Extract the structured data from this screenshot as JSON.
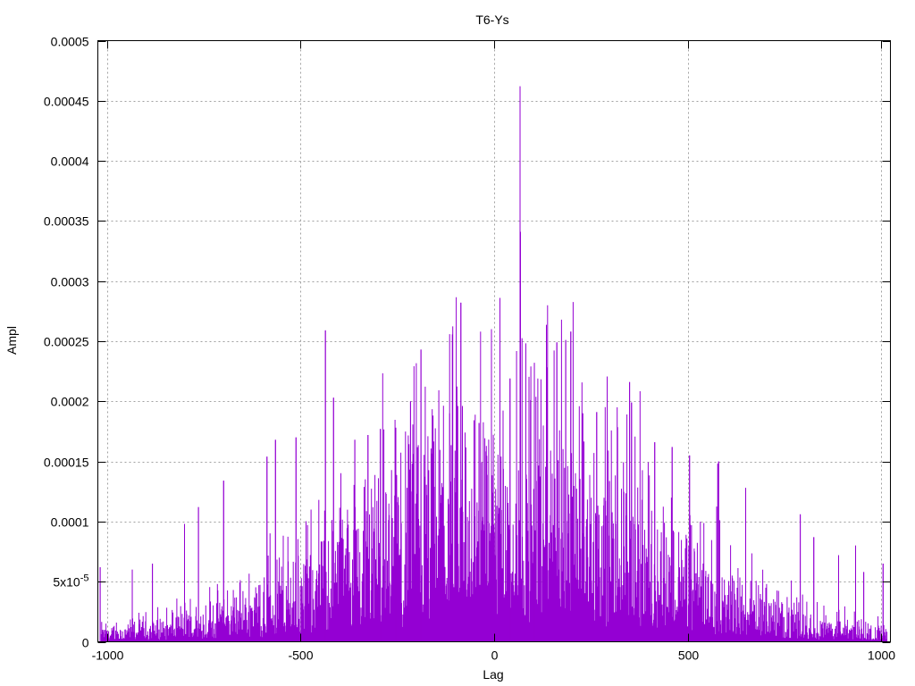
{
  "chart_data": {
    "type": "bar",
    "title": "T6-Ys",
    "xlabel": "Lag",
    "ylabel": "Ampl",
    "xlim": [
      -1024,
      1024
    ],
    "ylim": [
      0,
      0.0005
    ],
    "grid": true,
    "x_ticks": [
      {
        "value": -1000,
        "label": "-1000"
      },
      {
        "value": -500,
        "label": "-500"
      },
      {
        "value": 0,
        "label": "0"
      },
      {
        "value": 500,
        "label": "500"
      },
      {
        "value": 1000,
        "label": "1000"
      }
    ],
    "y_ticks": [
      {
        "value": 0,
        "label": "0"
      },
      {
        "value": 5e-05,
        "label": "5x10",
        "sup": "-5"
      },
      {
        "value": 0.0001,
        "label": "0.0001"
      },
      {
        "value": 0.00015,
        "label": "0.00015"
      },
      {
        "value": 0.0002,
        "label": "0.0002"
      },
      {
        "value": 0.00025,
        "label": "0.00025"
      },
      {
        "value": 0.0003,
        "label": "0.0003"
      },
      {
        "value": 0.00035,
        "label": "0.00035"
      },
      {
        "value": 0.0004,
        "label": "0.0004"
      },
      {
        "value": 0.00045,
        "label": "0.00045"
      },
      {
        "value": 0.0005,
        "label": "0.0005"
      }
    ],
    "series": [
      {
        "color": "#9400d3",
        "peaks": [
          {
            "x": 67,
            "y": 0.000462
          },
          {
            "x": 68,
            "y": 0.000341
          },
          {
            "x": 15,
            "y": 0.000286
          },
          {
            "x": -86,
            "y": 0.000282
          },
          {
            "x": -436,
            "y": 0.000259
          },
          {
            "x": 198,
            "y": 0.000258
          },
          {
            "x": 185,
            "y": 0.000251
          },
          {
            "x": 162,
            "y": 0.000249
          },
          {
            "x": -189,
            "y": 0.000243
          },
          {
            "x": 104,
            "y": 0.000232
          },
          {
            "x": 41,
            "y": 0.000219
          },
          {
            "x": 350,
            "y": 0.000216
          },
          {
            "x": -415,
            "y": 0.000203
          },
          {
            "x": 355,
            "y": 0.000199
          },
          {
            "x": -216,
            "y": 0.0002
          },
          {
            "x": -115,
            "y": 0.00019
          },
          {
            "x": 265,
            "y": 0.000191
          },
          {
            "x": -39,
            "y": 0.000182
          },
          {
            "x": 229,
            "y": 0.00019
          },
          {
            "x": -326,
            "y": 0.000172
          },
          {
            "x": -294,
            "y": 0.000177
          },
          {
            "x": -254,
            "y": 0.000178
          },
          {
            "x": -512,
            "y": 0.00017
          },
          {
            "x": -565,
            "y": 0.000168
          },
          {
            "x": -360,
            "y": 0.000168
          },
          {
            "x": 415,
            "y": 0.000166
          },
          {
            "x": 460,
            "y": 0.000162
          },
          {
            "x": -587,
            "y": 0.000154
          },
          {
            "x": 505,
            "y": 0.000155
          },
          {
            "x": 580,
            "y": 0.00015
          },
          {
            "x": 578,
            "y": 0.000148
          },
          {
            "x": -699,
            "y": 0.000134
          },
          {
            "x": 650,
            "y": 0.000128
          },
          {
            "x": -764,
            "y": 0.000112
          },
          {
            "x": -800,
            "y": 9.8e-05
          },
          {
            "x": 791,
            "y": 0.000106
          },
          {
            "x": 826,
            "y": 8.7e-05
          },
          {
            "x": 934,
            "y": 8e-05
          },
          {
            "x": 1005,
            "y": 6.5e-05
          },
          {
            "x": -1018,
            "y": 6.2e-05
          },
          {
            "x": -935,
            "y": 6e-05
          },
          {
            "x": -883,
            "y": 6.5e-05
          },
          {
            "x": 890,
            "y": 7.2e-05
          },
          {
            "x": 955,
            "y": 5.8e-05
          }
        ]
      }
    ]
  }
}
